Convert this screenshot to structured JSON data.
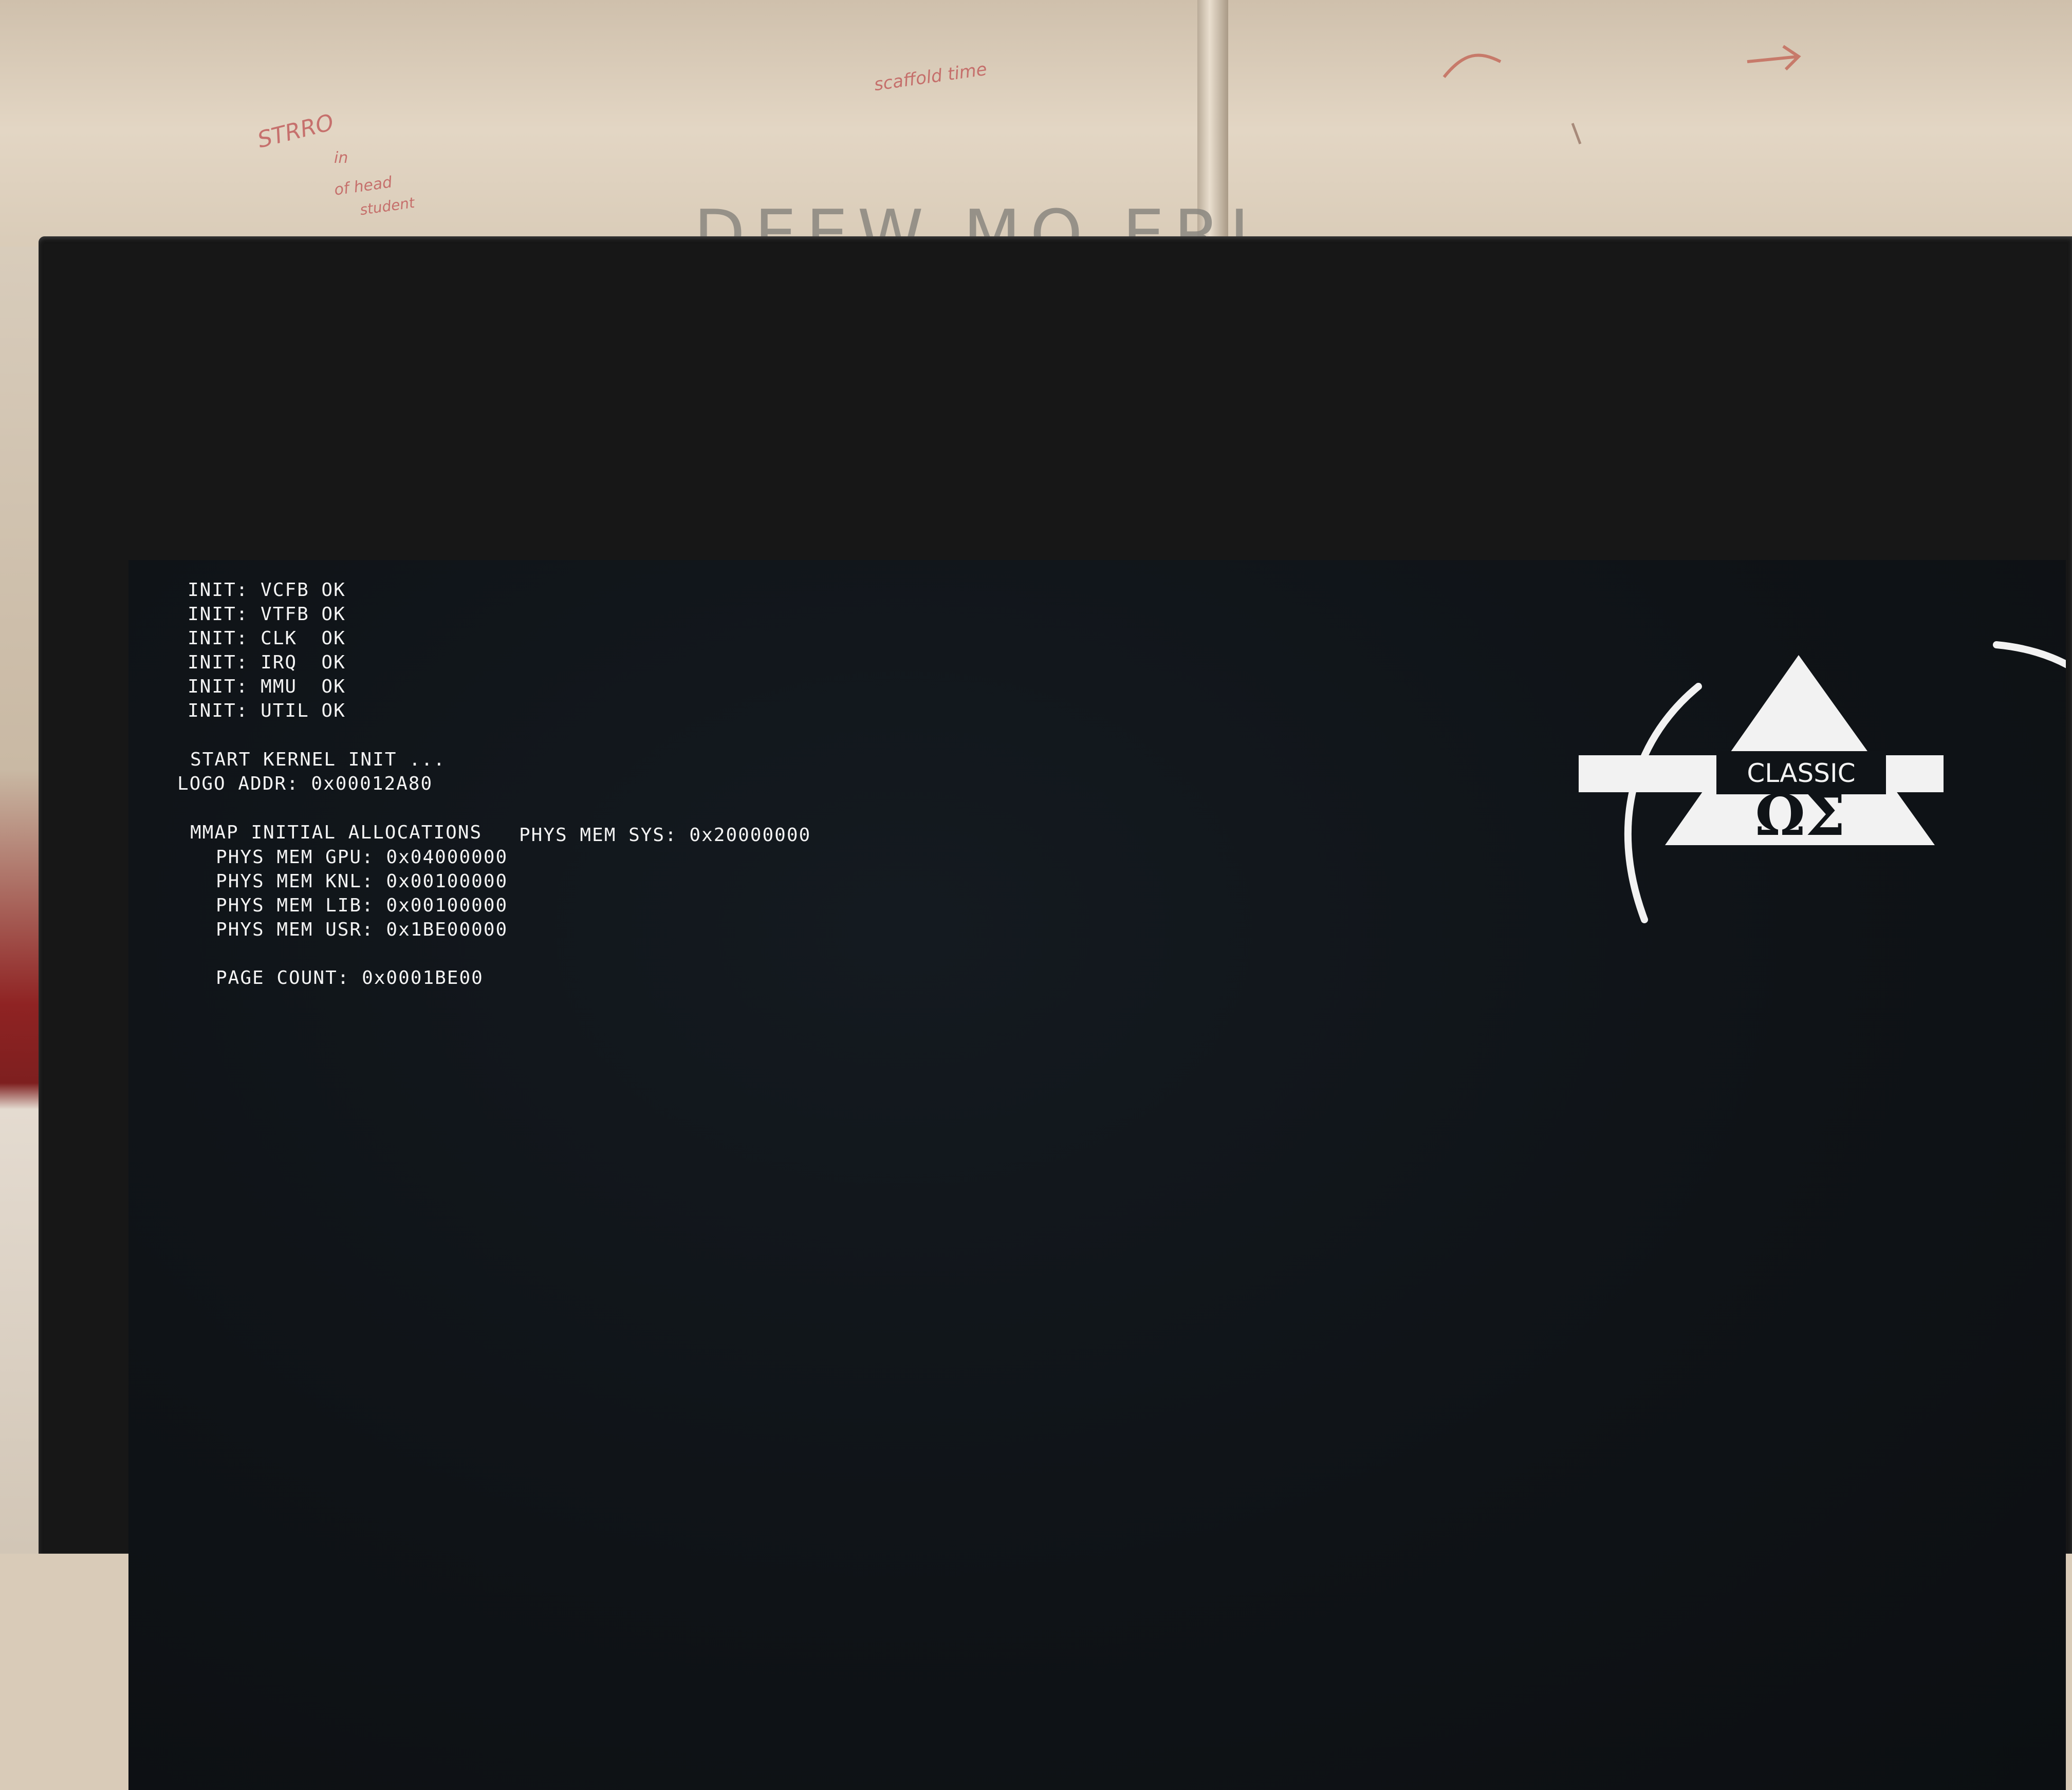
{
  "whiteboard": {
    "big_text": "DEEW MQ ERI",
    "scribbles": [
      "STRRO",
      "in",
      "of head",
      "student",
      "scaffold time"
    ]
  },
  "console": {
    "init_lines": [
      "INIT: VCFB OK",
      "INIT: VTFB OK",
      "INIT: CLK  OK",
      "INIT: IRQ  OK",
      "INIT: MMU  OK",
      "INIT: UTIL OK"
    ],
    "kernel_start": "START KERNEL INIT ...",
    "logo_addr": "LOGO ADDR: 0x00012A80",
    "mmap_header": "MMAP INITIAL ALLOCATIONS",
    "phys_mem_sys": "PHYS MEM SYS: 0x20000000",
    "phys_mem": [
      "PHYS MEM GPU: 0x04000000",
      "PHYS MEM KNL: 0x00100000",
      "PHYS MEM LIB: 0x00100000",
      "PHYS MEM USR: 0x1BE00000"
    ],
    "page_count": "PAGE COUNT: 0x0001BE00"
  },
  "logo": {
    "word": "CLASSIC",
    "symbols": "ΩΣ"
  },
  "colors": {
    "screen_bg": "#0f1317",
    "console_text": "#f4f4f4",
    "bezel": "#171717",
    "marker_red": "#c05858"
  }
}
